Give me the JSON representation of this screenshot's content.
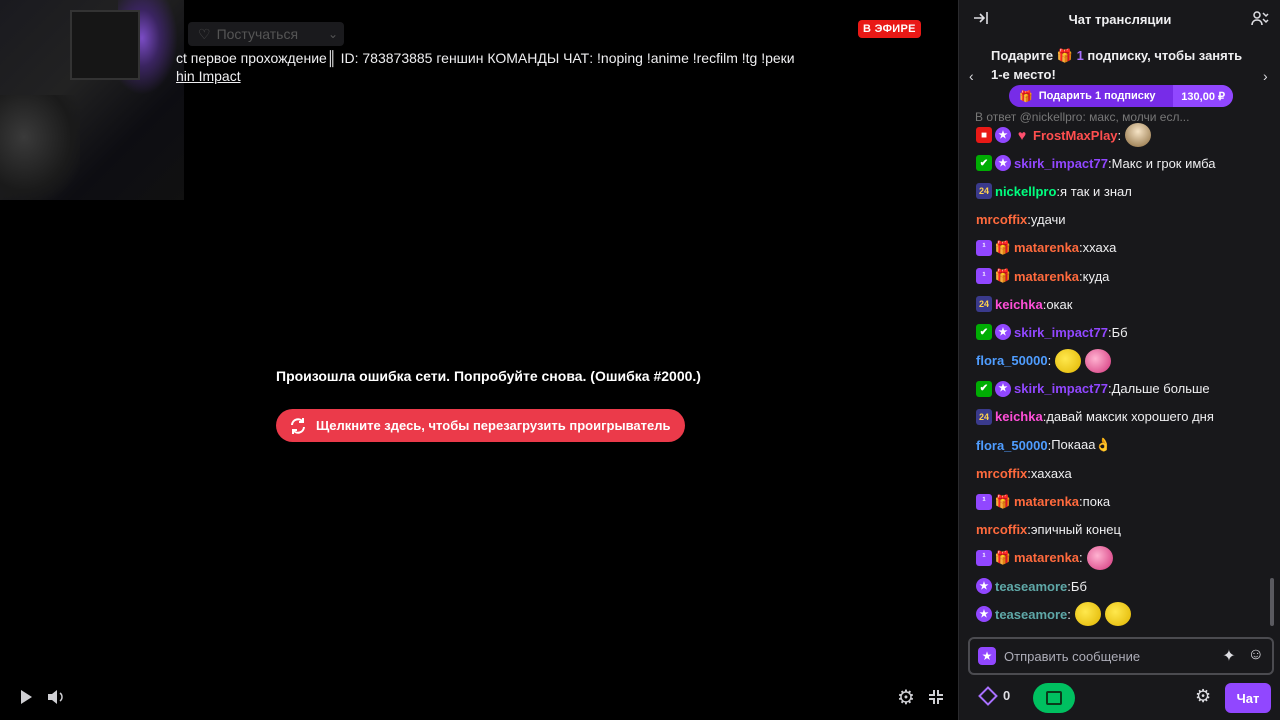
{
  "player": {
    "follow_label": "Постучаться",
    "title": "ct первое прохождение║ ID: 783873885 геншин КОМАНДЫ ЧАТ: !noping !anime !recfilm !tg !реки",
    "category": "hin Impact",
    "live_badge": "В ЭФИРЕ",
    "error_text": "Произошла ошибка сети. Попробуйте снова. (Ошибка #2000.)",
    "reload_label": "Щелкните здесь, чтобы перезагрузить проигрыватель"
  },
  "chat": {
    "header_title": "Чат трансляции",
    "gift_banner": {
      "text_prefix": "Подарите",
      "count": "1",
      "text_suffix": "подписку, чтобы занять 1-е место!",
      "button_label": "Подарить 1 подписку",
      "price": "130,00 ₽"
    },
    "partial_reply": "В ответ @nickellpro: макс, молчи есл...",
    "messages": [
      {
        "badges": [
          "cam",
          "star",
          "heart"
        ],
        "user": "FrostMaxPlay",
        "color": "#ff4f4f",
        "text": "",
        "emotes": [
          "girl"
        ]
      },
      {
        "badges": [
          "mod",
          "star"
        ],
        "user": "skirk_impact77",
        "color": "#9147ff",
        "text": "Макс и грок имба",
        "emotes": []
      },
      {
        "badges": [
          "24"
        ],
        "user": "nickellpro",
        "color": "#00ff7f",
        "text": "я так и знал",
        "emotes": []
      },
      {
        "badges": [],
        "user": "mrcoffix",
        "color": "#ff6a3d",
        "text": "удачи",
        "emotes": []
      },
      {
        "badges": [
          "sub",
          "gift"
        ],
        "user": "matarenka",
        "color": "#ff6a3d",
        "text": "ххаха",
        "emotes": []
      },
      {
        "badges": [
          "sub",
          "gift"
        ],
        "user": "matarenka",
        "color": "#ff6a3d",
        "text": "куда",
        "emotes": []
      },
      {
        "badges": [
          "24"
        ],
        "user": "keichka",
        "color": "#ff4fd8",
        "text": "окак",
        "emotes": []
      },
      {
        "badges": [
          "mod",
          "star"
        ],
        "user": "skirk_impact77",
        "color": "#9147ff",
        "text": "Бб",
        "emotes": []
      },
      {
        "badges": [],
        "user": "flora_50000",
        "color": "#4f9dff",
        "text": "",
        "emotes": [
          "gold",
          "pink"
        ]
      },
      {
        "badges": [
          "mod",
          "star"
        ],
        "user": "skirk_impact77",
        "color": "#9147ff",
        "text": "Дальше больше",
        "emotes": []
      },
      {
        "badges": [
          "24"
        ],
        "user": "keichka",
        "color": "#ff4fd8",
        "text": "давай максик хорошего дня",
        "emotes": []
      },
      {
        "badges": [],
        "user": "flora_50000",
        "color": "#4f9dff",
        "text": "Покааа👌",
        "emotes": []
      },
      {
        "badges": [],
        "user": "mrcoffix",
        "color": "#ff6a3d",
        "text": "хахаха",
        "emotes": []
      },
      {
        "badges": [
          "sub",
          "gift"
        ],
        "user": "matarenka",
        "color": "#ff6a3d",
        "text": "пока",
        "emotes": []
      },
      {
        "badges": [],
        "user": "mrcoffix",
        "color": "#ff6a3d",
        "text": "эпичный конец",
        "emotes": []
      },
      {
        "badges": [
          "sub",
          "gift"
        ],
        "user": "matarenka",
        "color": "#ff6a3d",
        "text": "",
        "emotes": [
          "pink"
        ]
      },
      {
        "badges": [
          "star"
        ],
        "user": "teaseamore",
        "color": "#5fa8a8",
        "text": "Бб",
        "emotes": []
      },
      {
        "badges": [
          "star"
        ],
        "user": "teaseamore",
        "color": "#5fa8a8",
        "text": "",
        "emotes": [
          "gold",
          "gold"
        ]
      }
    ],
    "input_placeholder": "Отправить сообщение",
    "points": "0",
    "chat_button": "Чат"
  },
  "colors": {
    "accent": "#9147ff",
    "live": "#e91916",
    "reload": "#eb3a4a",
    "prediction": "#00c060"
  }
}
